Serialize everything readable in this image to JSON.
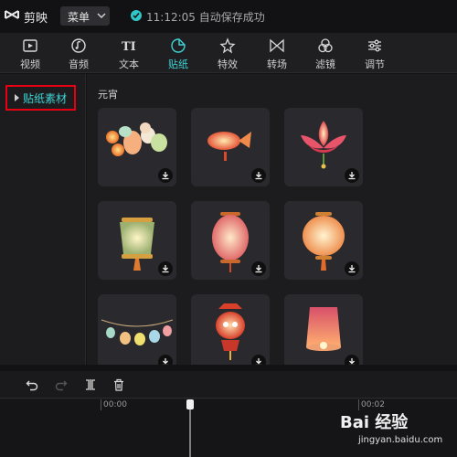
{
  "titlebar": {
    "app_name": "剪映",
    "menu_label": "菜单",
    "save_status": "11:12:05 自动保存成功"
  },
  "toolbar": {
    "tools": [
      {
        "label": "视频",
        "icon": "video-icon"
      },
      {
        "label": "音频",
        "icon": "audio-icon"
      },
      {
        "label": "文本",
        "icon": "text-icon"
      },
      {
        "label": "贴纸",
        "icon": "sticker-icon",
        "active": true
      },
      {
        "label": "特效",
        "icon": "effects-icon"
      },
      {
        "label": "转场",
        "icon": "transition-icon"
      },
      {
        "label": "滤镜",
        "icon": "filter-icon"
      },
      {
        "label": "调节",
        "icon": "adjust-icon"
      }
    ]
  },
  "left_panel": {
    "category": "贴纸素材"
  },
  "content": {
    "section_title": "元宵",
    "stickers": [
      "lantern-cluster-sticker",
      "fish-lantern-sticker",
      "lotus-lantern-sticker",
      "green-lantern-sticker",
      "pink-lantern-sticker",
      "round-lantern-sticker",
      "lantern-string-sticker",
      "red-lantern-sticker",
      "sky-lantern-sticker"
    ]
  },
  "timeline": {
    "time_start": "00:00",
    "time_mark": "00:02"
  },
  "watermark": {
    "main": "Bai 经验",
    "sub": "jingyan.baidu.com"
  },
  "colors": {
    "accent": "#3fd4d4",
    "highlight_box": "#e60012",
    "background": "#121214",
    "panel": "#1c1c1f"
  }
}
